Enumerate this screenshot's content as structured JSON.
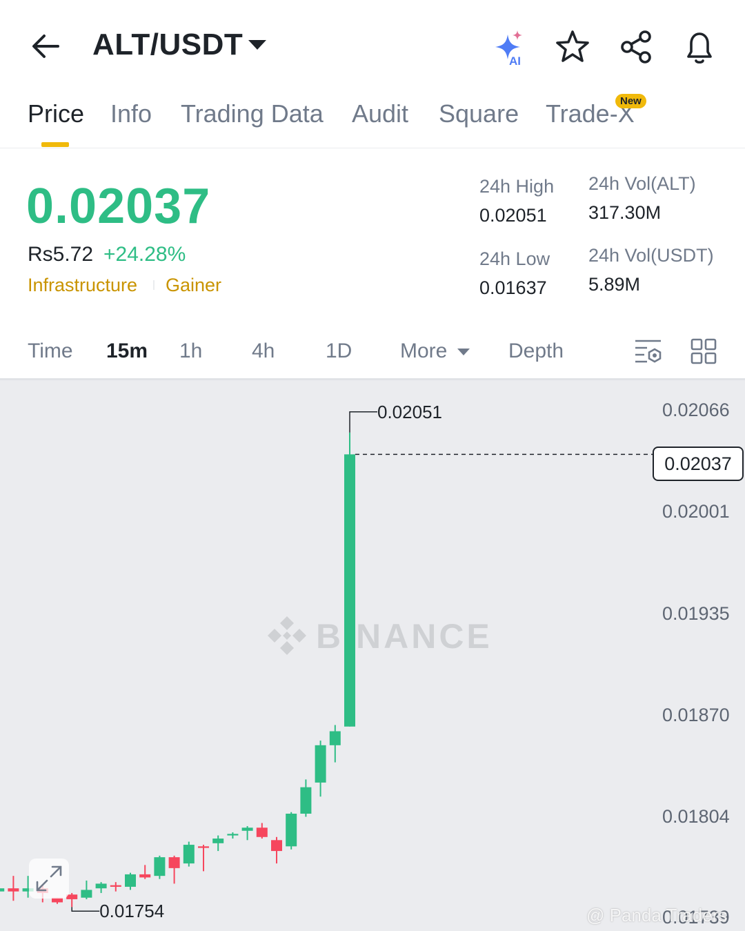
{
  "header": {
    "pair": "ALT/USDT",
    "icons": [
      "back-arrow-icon",
      "ai-sparkle-icon",
      "star-icon",
      "share-icon",
      "bell-icon"
    ],
    "ai_badge": "AI"
  },
  "tabs": [
    {
      "label": "Price",
      "active": true
    },
    {
      "label": "Info"
    },
    {
      "label": "Trading Data"
    },
    {
      "label": "Audit"
    },
    {
      "label": "Square"
    },
    {
      "label": "Trade-X",
      "badge": "New"
    }
  ],
  "price": {
    "last": "0.02037",
    "fiat": "Rs5.72",
    "change": "+24.28%",
    "tags": [
      "Infrastructure",
      "Gainer"
    ]
  },
  "stats": {
    "high_label": "24h High",
    "high_value": "0.02051",
    "low_label": "24h Low",
    "low_value": "0.01637",
    "vol_alt_label": "24h Vol(ALT)",
    "vol_alt_value": "317.30M",
    "vol_usdt_label": "24h Vol(USDT)",
    "vol_usdt_value": "5.89M"
  },
  "intervals": {
    "items": [
      "Time",
      "15m",
      "1h",
      "4h",
      "1D",
      "More",
      "Depth"
    ],
    "active": "15m"
  },
  "chart": {
    "axis": [
      "0.02066",
      "0.02001",
      "0.01935",
      "0.01870",
      "0.01804",
      "0.01739"
    ],
    "current_price": "0.02037",
    "high_marker": "0.02051",
    "low_marker": "0.01754",
    "watermark": "BINANCE",
    "credit": "@ Panda Traders",
    "colors": {
      "up": "#2ebd85",
      "down": "#f6465d",
      "bg": "#ebecef"
    }
  },
  "chart_data": {
    "type": "candlestick",
    "interval": "15m",
    "y_axis_ticks": [
      0.02066,
      0.02001,
      0.01935,
      0.0187,
      0.01804,
      0.01739
    ],
    "candles": [
      {
        "o": 0.0176,
        "h": 0.01768,
        "l": 0.01754,
        "c": 0.01764
      },
      {
        "o": 0.01764,
        "h": 0.01765,
        "l": 0.01748,
        "c": 0.0175
      },
      {
        "o": 0.01756,
        "h": 0.01765,
        "l": 0.01752,
        "c": 0.01758
      },
      {
        "o": 0.01758,
        "h": 0.01766,
        "l": 0.0175,
        "c": 0.01756
      },
      {
        "o": 0.01756,
        "h": 0.01766,
        "l": 0.01752,
        "c": 0.01758
      },
      {
        "o": 0.01758,
        "h": 0.0176,
        "l": 0.01749,
        "c": 0.01755
      },
      {
        "o": 0.01752,
        "h": 0.01752,
        "l": 0.01748,
        "c": 0.01749
      },
      {
        "o": 0.01754,
        "h": 0.01755,
        "l": 0.01746,
        "c": 0.01751
      },
      {
        "o": 0.01752,
        "h": 0.01763,
        "l": 0.01751,
        "c": 0.01757
      },
      {
        "o": 0.01758,
        "h": 0.01762,
        "l": 0.01755,
        "c": 0.01761
      },
      {
        "o": 0.0176,
        "h": 0.01762,
        "l": 0.01756,
        "c": 0.01759
      },
      {
        "o": 0.01759,
        "h": 0.01768,
        "l": 0.01757,
        "c": 0.01767
      },
      {
        "o": 0.01767,
        "h": 0.01773,
        "l": 0.01764,
        "c": 0.01765
      },
      {
        "o": 0.01766,
        "h": 0.01779,
        "l": 0.01764,
        "c": 0.01778
      },
      {
        "o": 0.01778,
        "h": 0.01779,
        "l": 0.01761,
        "c": 0.01771
      },
      {
        "o": 0.01774,
        "h": 0.01788,
        "l": 0.01772,
        "c": 0.01786
      },
      {
        "o": 0.01785,
        "h": 0.01786,
        "l": 0.01769,
        "c": 0.01784
      },
      {
        "o": 0.01787,
        "h": 0.01792,
        "l": 0.01782,
        "c": 0.0179
      },
      {
        "o": 0.01792,
        "h": 0.01794,
        "l": 0.0179,
        "c": 0.01793
      },
      {
        "o": 0.01795,
        "h": 0.01798,
        "l": 0.01789,
        "c": 0.01797
      },
      {
        "o": 0.01797,
        "h": 0.018,
        "l": 0.0179,
        "c": 0.01791
      },
      {
        "o": 0.01789,
        "h": 0.01791,
        "l": 0.01774,
        "c": 0.01782
      },
      {
        "o": 0.01785,
        "h": 0.01807,
        "l": 0.01783,
        "c": 0.01806
      },
      {
        "o": 0.01806,
        "h": 0.01828,
        "l": 0.01804,
        "c": 0.01823
      },
      {
        "o": 0.01826,
        "h": 0.01853,
        "l": 0.01817,
        "c": 0.0185
      },
      {
        "o": 0.0185,
        "h": 0.01863,
        "l": 0.01839,
        "c": 0.01859
      },
      {
        "o": 0.01862,
        "h": 0.02051,
        "l": 0.01862,
        "c": 0.02037
      }
    ]
  }
}
